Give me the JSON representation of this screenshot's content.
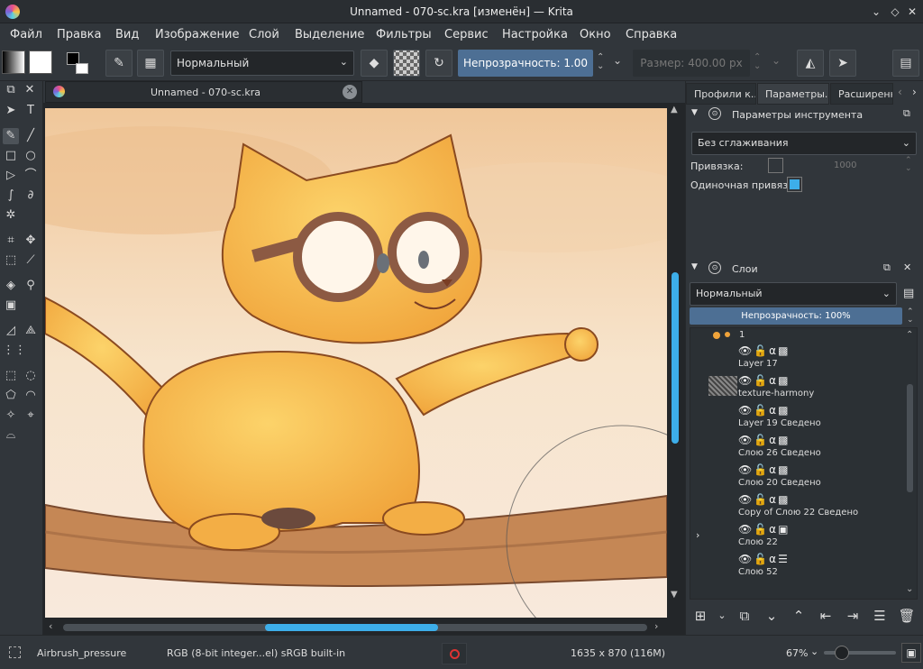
{
  "window": {
    "title": "Unnamed - 070-sc.kra [изменён] — Krita",
    "minimize": "⌄",
    "maximize": "◇",
    "close": "✕"
  },
  "menu": [
    "Файл",
    "Правка",
    "Вид",
    "Изображение",
    "Слой",
    "Выделение",
    "Фильтры",
    "Сервис",
    "Настройка",
    "Окно",
    "Справка"
  ],
  "toolbar": {
    "blend_mode": "Нормальный",
    "opacity_label": "Непрозрачность:",
    "opacity_value": "1.00",
    "size_label": "Размер:",
    "size_value": "400.00 px"
  },
  "document_tab": {
    "title": "Unnamed - 070-sc.kra",
    "close": "✕"
  },
  "right_tabs": [
    "Профили к...",
    "Параметры...",
    "Расширенн..."
  ],
  "tool_options": {
    "title": "Параметры инструмента",
    "smoothing": "Без сглаживания",
    "snap_label": "Привязка:",
    "snap_value": "1000",
    "single_snap_label": "Одиночная привязка:"
  },
  "layers": {
    "title": "Слои",
    "blend_mode": "Нормальный",
    "opacity_text": "Непрозрачность: 100%",
    "top_label": "1",
    "items": [
      {
        "name": "Layer 17"
      },
      {
        "name": "texture-harmony"
      },
      {
        "name": "Layer 19 Сведено"
      },
      {
        "name": "Слою 26 Сведено"
      },
      {
        "name": "Слою 20 Сведено"
      },
      {
        "name": "Copy of Слою 22 Сведено"
      },
      {
        "name": "Слою 22"
      },
      {
        "name": "Слою 52"
      }
    ]
  },
  "status": {
    "brush": "Airbrush_pressure",
    "color_space": "RGB (8-bit integer...el)  sRGB built-in",
    "dimensions": "1635 x 870 (116M)",
    "zoom": "67%"
  },
  "colors": {
    "accent": "#3daee9",
    "bg": "#31363b",
    "dark": "#232629",
    "slider": "#4d6f94"
  }
}
